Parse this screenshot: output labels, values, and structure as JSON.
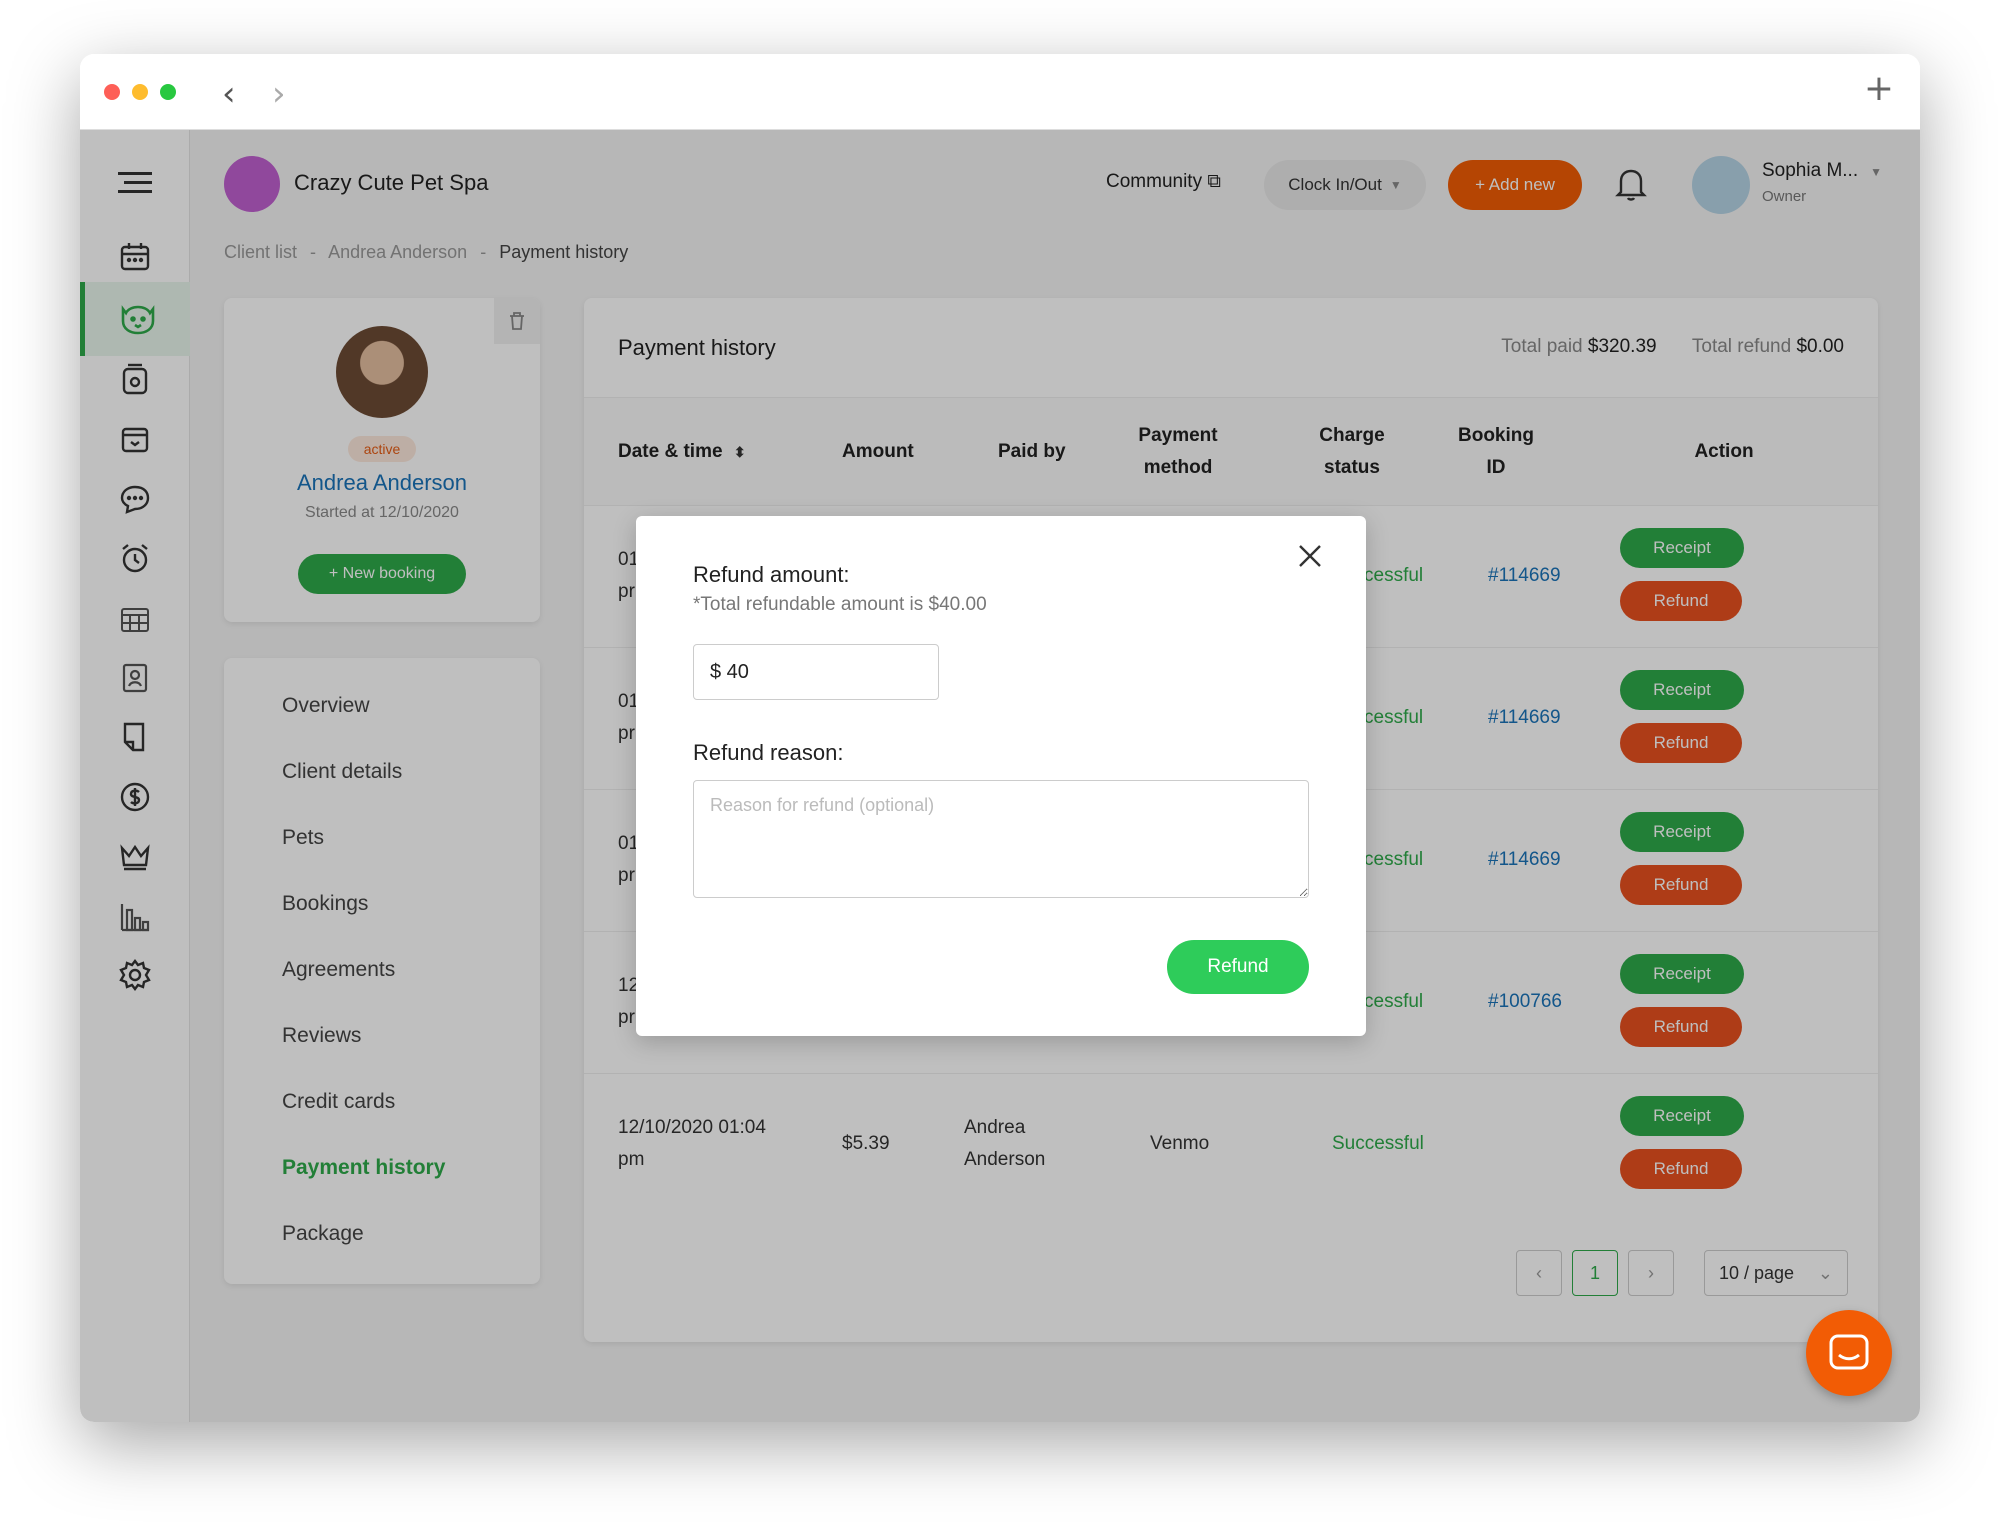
{
  "browser": {
    "back_icon": "chevron-left-icon",
    "forward_icon": "chevron-right-icon",
    "new_tab_icon": "plus-icon"
  },
  "header": {
    "business_name": "Crazy Cute Pet Spa",
    "community_label": "Community",
    "clock_label": "Clock In/Out",
    "add_new_label": "+ Add new",
    "user_name": "Sophia M...",
    "user_role": "Owner"
  },
  "breadcrumb": {
    "items": [
      "Client list",
      "Andrea Anderson",
      "Payment history"
    ],
    "separator": "-"
  },
  "profile": {
    "status": "active",
    "name": "Andrea Anderson",
    "since": "Started at 12/10/2020",
    "new_booking_label": "+ New booking"
  },
  "menu": {
    "items": [
      "Overview",
      "Client details",
      "Pets",
      "Bookings",
      "Agreements",
      "Reviews",
      "Credit cards",
      "Payment history",
      "Package"
    ],
    "active": "Payment history"
  },
  "payment": {
    "title": "Payment history",
    "total_paid_label": "Total paid",
    "total_paid": "$320.39",
    "total_refund_label": "Total refund",
    "total_refund": "$0.00",
    "columns": {
      "date": "Date & time",
      "amount": "Amount",
      "paid_by": "Paid by",
      "method_1": "Payment",
      "method_2": "method",
      "status_1": "Charge",
      "status_2": "status",
      "booking_1": "Booking",
      "booking_2": "ID",
      "action": "Action"
    },
    "rows": [
      {
        "date1": "01",
        "date2": "pr",
        "status": "cessful",
        "booking": "#114669"
      },
      {
        "date1": "01",
        "date2": "pr",
        "status": "cessful",
        "booking": "#114669"
      },
      {
        "date1": "01",
        "date2": "pr",
        "status": "cessful",
        "booking": "#114669"
      },
      {
        "date1": "12",
        "date2": "pr",
        "status": "cessful",
        "booking": "#100766"
      },
      {
        "date1": "12/10/2020 01:04",
        "date2": "pm",
        "amount": "$5.39",
        "paid1": "Andrea",
        "paid2": "Anderson",
        "method": "Venmo",
        "status": "Successful",
        "booking": ""
      }
    ],
    "receipt_label": "Receipt",
    "refund_label": "Refund",
    "pagination": {
      "current": "1",
      "page_size": "10 / page"
    }
  },
  "modal": {
    "amount_label": "Refund amount:",
    "amount_note": "*Total refundable amount is $40.00",
    "amount_value": "$ 40",
    "reason_label": "Refund reason:",
    "reason_placeholder": "Reason for refund (optional)",
    "submit_label": "Refund"
  },
  "colors": {
    "brand_green": "#2eaa4a",
    "brand_orange": "#f25c05",
    "refund_red": "#e8501f",
    "link_blue": "#1a73b8"
  }
}
